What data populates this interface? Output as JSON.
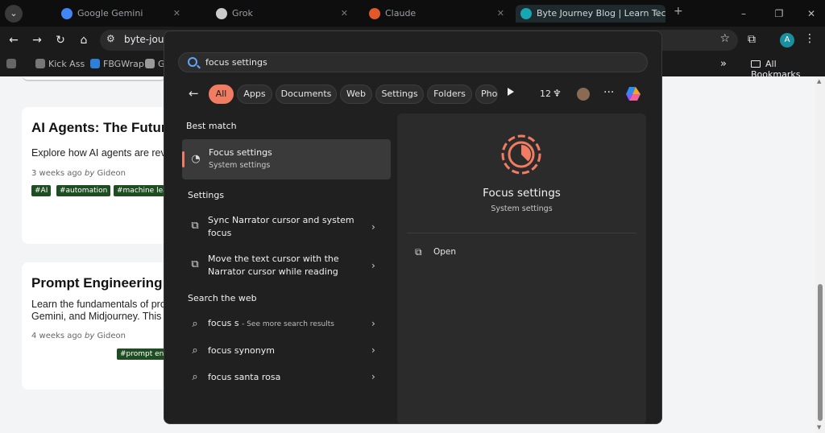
{
  "browser": {
    "tabs": [
      {
        "label": "Google Gemini",
        "color": "#4285f4"
      },
      {
        "label": "Grok",
        "color": "#cccccc"
      },
      {
        "label": "Claude",
        "color": "#e0592a"
      },
      {
        "label": "Byte Journey Blog | Learn Tech",
        "color": "#19a6b3"
      }
    ],
    "address": "byte-journey.vercel.app",
    "profile_initial": "A",
    "bookmarks": [
      "Kick Ass",
      "FBGWrap",
      "G..."
    ],
    "all_bookmarks": "All Bookmarks"
  },
  "page": {
    "cards": [
      {
        "title": "AI Agents: The Future of Automation",
        "desc": [
          "Explore how AI agents are revolutionizing"
        ],
        "meta_time": "3 weeks ago",
        "meta_by": "by",
        "meta_author": "Gideon",
        "tags": [
          "#AI",
          "#automation",
          "#machine learning"
        ]
      },
      {
        "title": "Prompt Engineering Guide",
        "desc": [
          "Learn the fundamentals of prompt engineering with",
          "Gemini, and Midjourney. This guide"
        ],
        "meta_time": "4 weeks ago",
        "meta_by": "by",
        "meta_author": "Gideon",
        "tags": [
          "#prompt engineering"
        ]
      }
    ]
  },
  "search": {
    "query": "focus settings",
    "filters": [
      "All",
      "Apps",
      "Documents",
      "Web",
      "Settings",
      "Folders",
      "Photos"
    ],
    "active_filter": "All",
    "points": "12",
    "best_match_heading": "Best match",
    "best_match": {
      "title": "Focus settings",
      "subtitle": "System settings"
    },
    "settings_heading": "Settings",
    "settings_results": [
      {
        "line1": "Sync Narrator cursor and system",
        "line2": "focus"
      },
      {
        "line1": "Move the text cursor with the",
        "line2": "Narrator cursor while reading"
      }
    ],
    "web_heading": "Search the web",
    "web_results": [
      {
        "text": "focus s",
        "hint": "- See more search results"
      },
      {
        "text": "focus synonym",
        "hint": ""
      },
      {
        "text": "focus santa rosa",
        "hint": ""
      }
    ],
    "preview": {
      "title": "Focus settings",
      "subtitle": "System settings",
      "action": "Open"
    }
  },
  "colors": {
    "accent": "#f07c62",
    "tag_bg": "#1e4d22"
  },
  "icons": [
    "search-icon",
    "back-arrow-icon",
    "focus-icon",
    "narrator-icon",
    "chevron-right-icon",
    "open-external-icon",
    "copilot-icon"
  ]
}
